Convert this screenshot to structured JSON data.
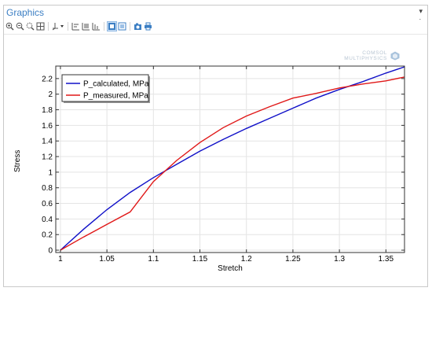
{
  "window": {
    "title": "Graphics",
    "toolbar_icons": [
      "zoom-in-icon",
      "zoom-out-icon",
      "zoom-box-icon",
      "zoom-extents-icon",
      "axis-dropdown-icon",
      "x-axis-icon",
      "x-axis-log-icon",
      "y-axis-icon",
      "legend-toggle-icon",
      "grid-toggle-icon",
      "camera-icon",
      "print-icon"
    ]
  },
  "logo": {
    "line1": "COMSOL",
    "line2": "MULTIPHYSICS"
  },
  "colors": {
    "calculated": "#1010c8",
    "measured": "#e01818",
    "accent": "#3c7fc4"
  },
  "chart_data": {
    "type": "line",
    "title": "",
    "xlabel": "Stretch",
    "ylabel": "Stress",
    "xlim": [
      0.995,
      1.37
    ],
    "ylim": [
      -0.03,
      2.36
    ],
    "xticks": [
      1,
      1.05,
      1.1,
      1.15,
      1.2,
      1.25,
      1.3,
      1.35
    ],
    "xtick_labels": [
      "1",
      "1.05",
      "1.1",
      "1.15",
      "1.2",
      "1.25",
      "1.3",
      "1.35"
    ],
    "yticks": [
      0,
      0.2,
      0.4,
      0.6,
      0.8,
      1,
      1.2,
      1.4,
      1.6,
      1.8,
      2,
      2.2
    ],
    "ytick_labels": [
      "0",
      "0.2",
      "0.4",
      "0.6",
      "0.8",
      "1",
      "1.2",
      "1.4",
      "1.6",
      "1.8",
      "2",
      "2.2"
    ],
    "grid": true,
    "legend_position": "top-left",
    "series": [
      {
        "name": "P_calculated, MPa",
        "x": [
          1,
          1.025,
          1.05,
          1.075,
          1.1,
          1.125,
          1.15,
          1.175,
          1.2,
          1.225,
          1.25,
          1.275,
          1.3,
          1.325,
          1.35,
          1.37
        ],
        "y": [
          0,
          0.27,
          0.52,
          0.74,
          0.93,
          1.1,
          1.27,
          1.42,
          1.56,
          1.69,
          1.82,
          1.95,
          2.06,
          2.16,
          2.27,
          2.35
        ]
      },
      {
        "name": "P_measured, MPa",
        "x": [
          1,
          1.025,
          1.05,
          1.075,
          1.1,
          1.125,
          1.15,
          1.175,
          1.2,
          1.225,
          1.25,
          1.275,
          1.3,
          1.325,
          1.35,
          1.37
        ],
        "y": [
          0,
          0.17,
          0.33,
          0.49,
          0.88,
          1.15,
          1.38,
          1.57,
          1.72,
          1.84,
          1.95,
          2.01,
          2.08,
          2.13,
          2.17,
          2.22
        ]
      }
    ]
  }
}
